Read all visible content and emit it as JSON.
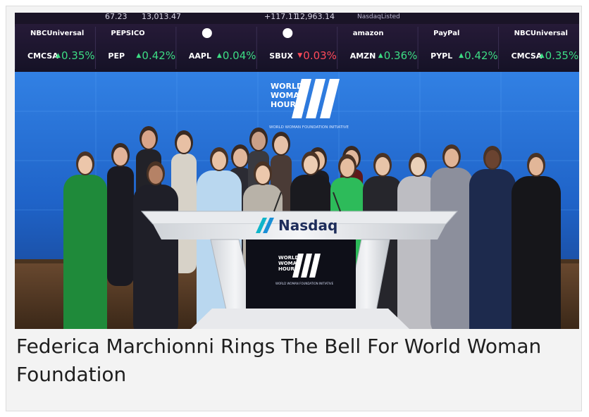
{
  "caption": "Federica Marchionni Rings The Bell For World Woman Foundation",
  "ticker_top": {
    "left_num": "13,013.47",
    "left_small": "67.23",
    "mid_change": "+117.11",
    "mid_value": "12,963.14",
    "listed": "NasdaqListed"
  },
  "tickers": [
    {
      "company": "NBCUniversal",
      "symbol": "CMCSA",
      "change": "0.35%",
      "dir": "up"
    },
    {
      "company": "PEPSICO",
      "symbol": "PEP",
      "change": "0.42%",
      "dir": "up"
    },
    {
      "company": "",
      "symbol": "AAPL",
      "change": "0.04%",
      "dir": "up"
    },
    {
      "company": "",
      "symbol": "SBUX",
      "change": "0.03%",
      "dir": "down"
    },
    {
      "company": "amazon",
      "symbol": "AMZN",
      "change": "0.36%",
      "dir": "up"
    },
    {
      "company": "PayPal",
      "symbol": "PYPL",
      "change": "0.42%",
      "dir": "up"
    },
    {
      "company": "NBCUniversal",
      "symbol": "CMCSA",
      "change": "0.35%",
      "dir": "up"
    }
  ],
  "wall_logo": {
    "line1": "WORLD",
    "line2": "WOMAN",
    "line3": "HOUR",
    "sub": "WORLD WOMAN FOUNDATION INITIATIVE"
  },
  "podium": {
    "brand": "Nasdaq",
    "screen_line1": "WORLD",
    "screen_line2": "WOMAN",
    "screen_line3": "HOUR",
    "screen_sub": "WORLD WOMAN FOUNDATION INITIATIVE"
  },
  "colors": {
    "up": "#3ddc84",
    "down": "#ff4a5a",
    "wall_blue": "#2d7fe0",
    "ticker_bg": "#1b1630",
    "nasdaq_teal": "#0fb5c9"
  }
}
